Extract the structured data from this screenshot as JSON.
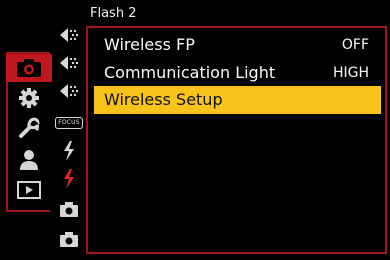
{
  "header": {
    "title": "Flash 2"
  },
  "menu": {
    "rows": [
      {
        "label": "Wireless FP",
        "value": "OFF"
      },
      {
        "label": "Communication Light",
        "value": "HIGH"
      },
      {
        "label": "Wireless Setup",
        "value": ""
      }
    ]
  },
  "sidebar": {
    "categories": [
      {
        "icon": "camera-icon",
        "active": true
      },
      {
        "icon": "gear-icon",
        "active": false
      },
      {
        "icon": "wrench-icon",
        "active": false
      },
      {
        "icon": "user-icon",
        "active": false
      },
      {
        "icon": "playback-icon",
        "active": false
      }
    ],
    "focus_badge": "FOCUS"
  },
  "colors": {
    "accent_red": "#c0171f",
    "frame_red": "#a2141b",
    "selection_yellow": "#f8c41b",
    "background": "#000000"
  }
}
